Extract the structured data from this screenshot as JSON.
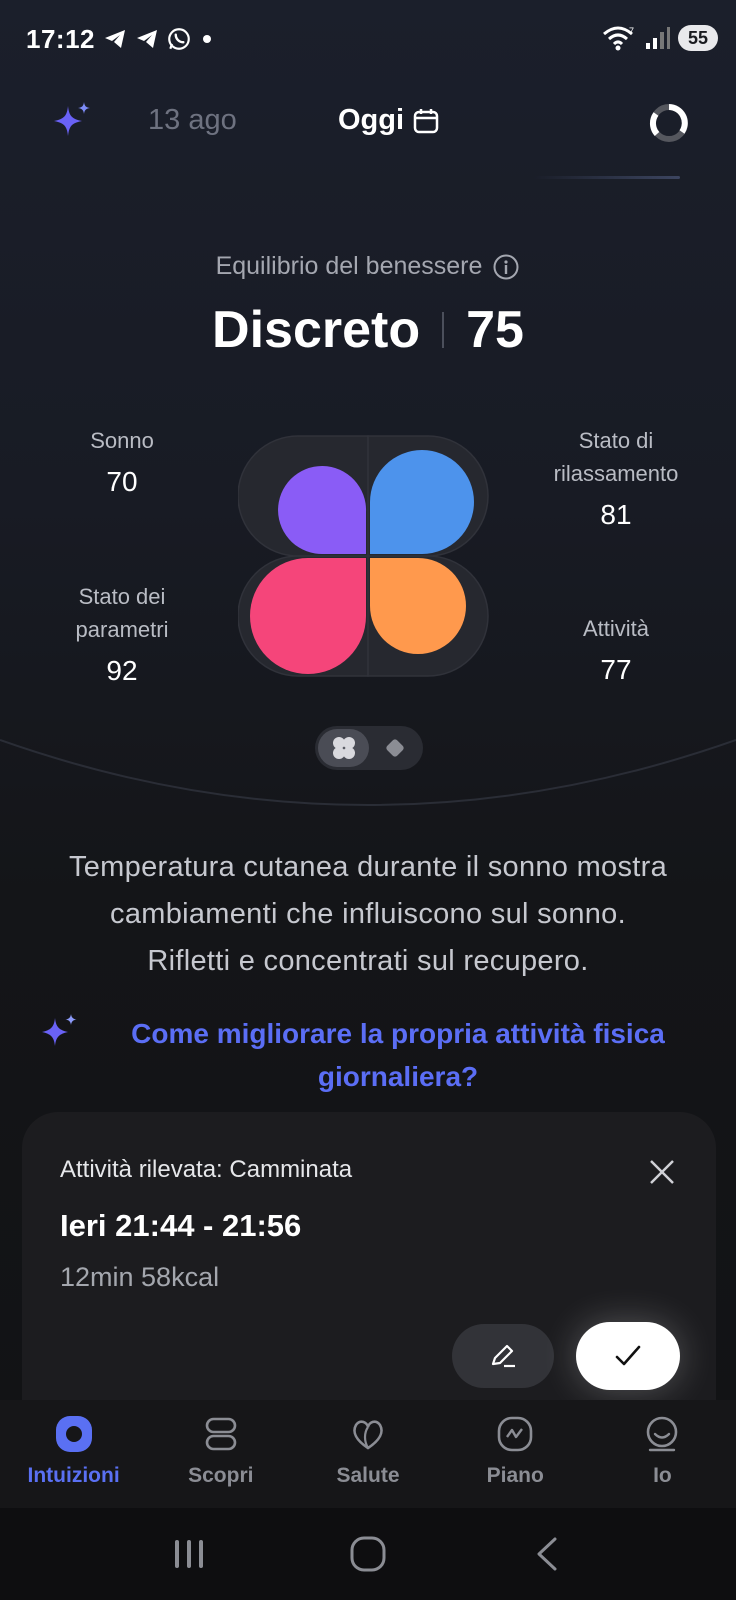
{
  "status_bar": {
    "time": "17:12",
    "battery": "55",
    "notification_icons": [
      "telegram-icon",
      "telegram-icon",
      "whatsapp-icon",
      "dot-icon"
    ]
  },
  "header": {
    "previous_date": "13 ago",
    "today_label": "Oggi"
  },
  "wellness": {
    "label": "Equilibrio del benessere",
    "status": "Discreto",
    "score": "75"
  },
  "metrics": {
    "sleep": {
      "label": "Sonno",
      "value": "70"
    },
    "relaxation": {
      "label_line1": "Stato di",
      "label_line2": "rilassamento",
      "value": "81"
    },
    "parameters": {
      "label_line1": "Stato dei",
      "label_line2": "parametri",
      "value": "92"
    },
    "activity": {
      "label": "Attività",
      "value": "77"
    }
  },
  "colors": {
    "sleep": "#8a5cf6",
    "relaxation": "#4d93ec",
    "parameters": "#f5457a",
    "activity": "#ff994d",
    "accent": "#5b6ef5"
  },
  "insight": {
    "line1": "Temperatura cutanea durante il sonno mostra",
    "line2": "cambiamenti che influiscono sul sonno.",
    "line3": "Rifletti e concentrati sul recupero."
  },
  "ask": {
    "line1": "Come migliorare la propria attività fisica",
    "line2": "giornaliera?"
  },
  "activity_card": {
    "title": "Attività rilevata: Camminata",
    "time_range": "Ieri 21:44 - 21:56",
    "stats": "12min 58kcal"
  },
  "nav": {
    "items": [
      {
        "label": "Intuizioni",
        "icon": "insights-icon",
        "active": true
      },
      {
        "label": "Scopri",
        "icon": "discover-icon",
        "active": false
      },
      {
        "label": "Salute",
        "icon": "health-icon",
        "active": false
      },
      {
        "label": "Piano",
        "icon": "plan-icon",
        "active": false
      },
      {
        "label": "Io",
        "icon": "profile-icon",
        "active": false
      }
    ]
  }
}
